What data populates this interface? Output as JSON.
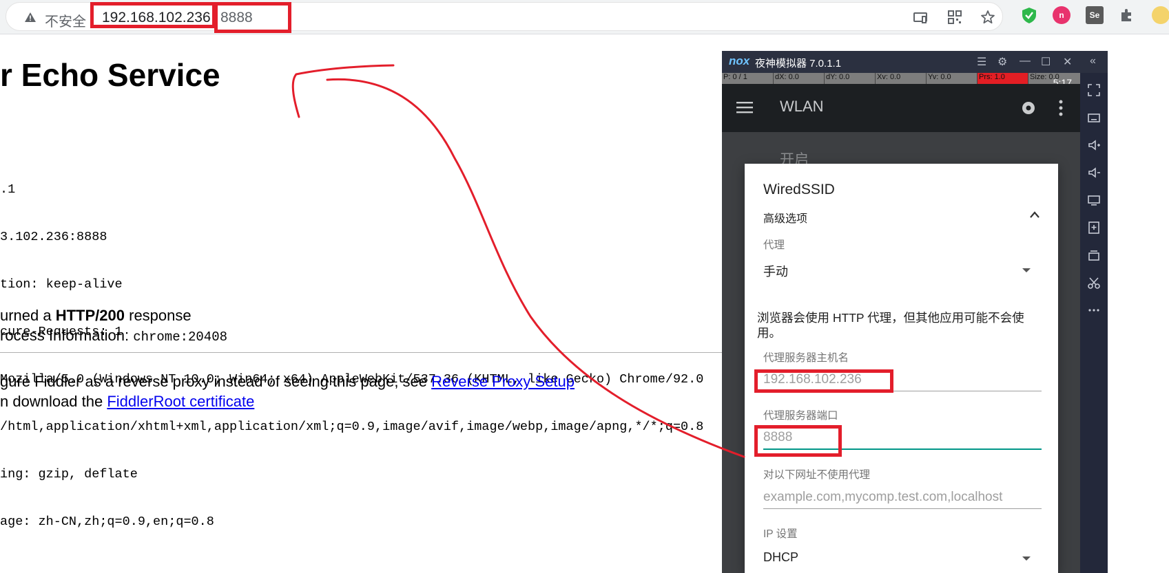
{
  "browser": {
    "insecure_label": "不安全",
    "url_host": "192.168.102.236",
    "url_port": "8888"
  },
  "page": {
    "heading": "r Echo Service",
    "request_lines": [
      ".1",
      "3.102.236:8888",
      "tion: keep-alive",
      "cure-Requests: 1",
      "Mozilla/5.0 (Windows NT 10.0; Win64; x64) AppleWebKit/537.36 (KHTML, like Gecko) Chrome/92.0",
      "/html,application/xhtml+xml,application/xml;q=0.9,image/avif,image/webp,image/apng,*/*;q=0.8",
      "ing: gzip, deflate",
      "age: zh-CN,zh;q=0.9,en;q=0.8"
    ],
    "response_prefix": "urned a ",
    "response_status": "HTTP/200",
    "response_suffix": " response",
    "process_prefix": "rocess Information: ",
    "process_value": "chrome:20408",
    "reverse_text": "gure Fiddler as a reverse proxy instead of seeing this page, see ",
    "reverse_link": "Reverse Proxy Setup",
    "cert_text": "n download the ",
    "cert_link": "FiddlerRoot certificate"
  },
  "emulator": {
    "logo": "nox",
    "title": "夜神模拟器 7.0.1.1",
    "status": {
      "p": "P: 0 / 1",
      "dx": "dX: 0.0",
      "dy": "dY: 0.0",
      "xv": "Xv: 0.0",
      "yv": "Yv: 0.0",
      "prs": "Prs: 1.0",
      "size": "Size: 0.0"
    },
    "time": "5:17",
    "screen_title": "WLAN",
    "switch_label": "开启"
  },
  "dialog": {
    "title": "WiredSSID",
    "advanced": "高级选项",
    "proxy_label": "代理",
    "proxy_value": "手动",
    "note": "浏览器会使用 HTTP 代理，但其他应用可能不会使用。",
    "host_label": "代理服务器主机名",
    "host_value": "192.168.102.236",
    "port_label": "代理服务器端口",
    "port_value": "8888",
    "bypass_label": "对以下网址不使用代理",
    "bypass_placeholder": "example.com,mycomp.test.com,localhost",
    "ip_label": "IP 设置",
    "ip_value": "DHCP"
  },
  "colors": {
    "annotation_red": "#e31e2b",
    "link_blue": "#0000ee",
    "focus_teal": "#009688"
  }
}
